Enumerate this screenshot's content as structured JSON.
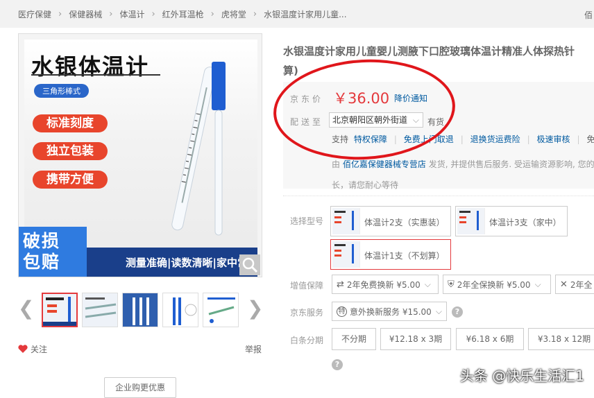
{
  "breadcrumb": {
    "items": [
      "医疗保健",
      "保健器械",
      "体温计",
      "红外耳温枪",
      "虎将堂",
      "水银温度计家用儿童..."
    ],
    "separator": "›",
    "right_cut": "佰"
  },
  "gallery": {
    "main_image": {
      "title": "水银体温计",
      "subtitle": "三角形棒式",
      "pills": [
        "标准刻度",
        "独立包装",
        "携带方便"
      ],
      "side_badge": [
        "破损",
        "包赔"
      ],
      "banner": "测量准确|读数清晰|家中常"
    },
    "thumbnail_count": 5,
    "selected_thumbnail": 0,
    "follow_label": "关注",
    "report_label": "举报",
    "enterprise_label": "企业购更优惠"
  },
  "product": {
    "title_line1": "水银温度计家用儿童婴儿测腋下口腔玻璃体温计精准人体探热针",
    "title_line2": "算)",
    "price_label": "京东价",
    "price": "￥36.00",
    "price_notice": "降价通知",
    "deliver_label": "配送至",
    "address": "北京朝阳区朝外街道",
    "stock": "有货",
    "services_label": "支持",
    "services": [
      "特权保障",
      "免费上门取退",
      "退换货运费险",
      "极速审核",
      "免运费"
    ],
    "shipping_prefix": "由",
    "shop_name": "佰亿嘉保健器械专营店",
    "shipping_text": "发货, 并提供售后服务. 受运输资源影响, 您的",
    "shipping_text2": "长，请您耐心等待"
  },
  "options": {
    "model_label": "选择型号",
    "models": [
      {
        "label": "体温计2支（实惠装）",
        "selected": false
      },
      {
        "label": "体温计3支（家中）",
        "selected": false
      },
      {
        "label": "体温计1支（不划算）",
        "selected": true
      }
    ],
    "value_label": "增值保障",
    "value_items": [
      "2年免费换新 ¥5.00",
      "2年全保换新 ¥5.00",
      "2年全"
    ],
    "jd_service_label": "京东服务",
    "jd_service": "意外换新服务 ¥15.00",
    "installment_label": "白条分期",
    "installments": [
      "不分期",
      "¥12.18 x 3期",
      "¥6.18 x 6期",
      "¥3.18 x 12期"
    ]
  },
  "watermark": "头条 @快乐生活汇1",
  "colors": {
    "price": "#e4393c",
    "link": "#005aa0",
    "annotation": "#e0161b"
  }
}
